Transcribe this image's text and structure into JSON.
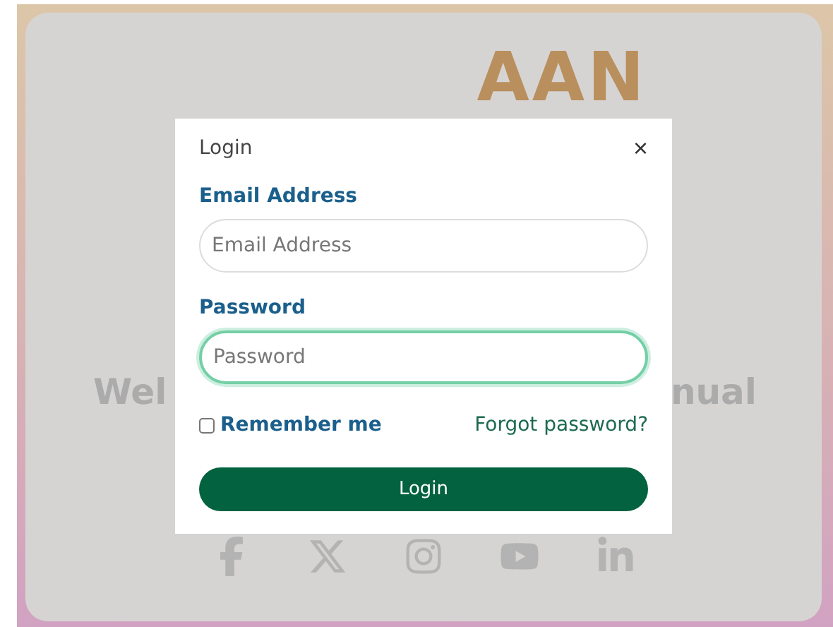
{
  "background": {
    "logo_text": "AAN",
    "heading_left": "Wel",
    "heading_right": "nual",
    "social": [
      {
        "kind": "facebook"
      },
      {
        "kind": "x"
      },
      {
        "kind": "instagram"
      },
      {
        "kind": "youtube"
      },
      {
        "kind": "linkedin"
      }
    ]
  },
  "modal": {
    "title": "Login",
    "close": "×",
    "fields": [
      {
        "label": "Email Address",
        "placeholder": "Email Address",
        "focused": false
      },
      {
        "label": "Password",
        "placeholder": "Password",
        "focused": true
      }
    ],
    "remember": {
      "label": "Remember me",
      "checked": false
    },
    "forgot": "Forgot password?",
    "submit": "Login"
  }
}
